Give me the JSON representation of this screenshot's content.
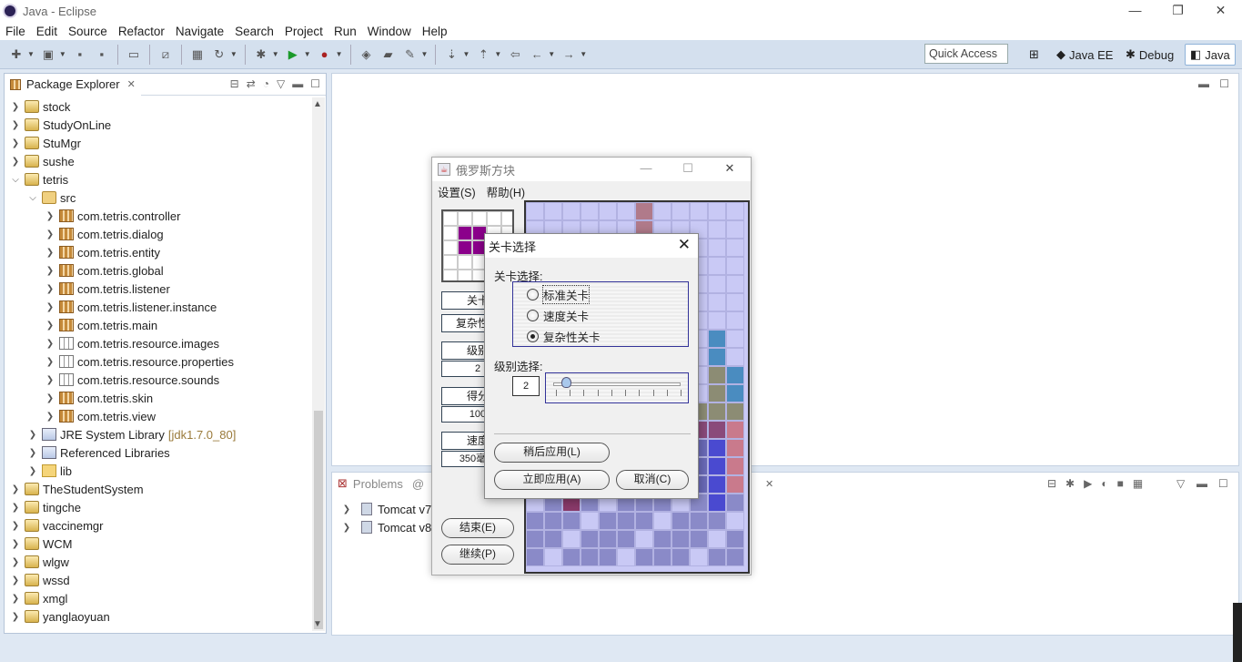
{
  "window": {
    "title": "Java - Eclipse",
    "minimize": "—",
    "restore": "❐",
    "close": "✕"
  },
  "menu": [
    "File",
    "Edit",
    "Source",
    "Refactor",
    "Navigate",
    "Search",
    "Project",
    "Run",
    "Window",
    "Help"
  ],
  "quick_access": "Quick Access",
  "perspectives": {
    "javaee": "Java EE",
    "debug": "Debug",
    "java": "Java"
  },
  "explorer": {
    "tab": "Package Explorer",
    "rows": [
      {
        "label": "stock",
        "deco": ""
      },
      {
        "label": "StudyOnLine",
        "deco": ""
      },
      {
        "label": "StuMgr",
        "deco": ""
      },
      {
        "label": "sushe",
        "deco": ""
      },
      {
        "label": "tetris",
        "deco": ""
      },
      {
        "label": "src",
        "deco": ""
      },
      {
        "label": "com.tetris.controller",
        "deco": ""
      },
      {
        "label": "com.tetris.dialog",
        "deco": ""
      },
      {
        "label": "com.tetris.entity",
        "deco": ""
      },
      {
        "label": "com.tetris.global",
        "deco": ""
      },
      {
        "label": "com.tetris.listener",
        "deco": ""
      },
      {
        "label": "com.tetris.listener.instance",
        "deco": ""
      },
      {
        "label": "com.tetris.main",
        "deco": ""
      },
      {
        "label": "com.tetris.resource.images",
        "deco": ""
      },
      {
        "label": "com.tetris.resource.properties",
        "deco": ""
      },
      {
        "label": "com.tetris.resource.sounds",
        "deco": ""
      },
      {
        "label": "com.tetris.skin",
        "deco": ""
      },
      {
        "label": "com.tetris.view",
        "deco": ""
      },
      {
        "label": "JRE System Library",
        "deco": "[jdk1.7.0_80]"
      },
      {
        "label": "Referenced Libraries",
        "deco": ""
      },
      {
        "label": "lib",
        "deco": ""
      },
      {
        "label": "TheStudentSystem",
        "deco": ""
      },
      {
        "label": "tingche",
        "deco": ""
      },
      {
        "label": "vaccinemgr",
        "deco": ""
      },
      {
        "label": "WCM",
        "deco": ""
      },
      {
        "label": "wlgw",
        "deco": ""
      },
      {
        "label": "wssd",
        "deco": ""
      },
      {
        "label": "xmgl",
        "deco": ""
      },
      {
        "label": "yanglaoyuan",
        "deco": ""
      }
    ]
  },
  "bottom": {
    "problems_tab": "Problems",
    "servers_tab_suffix": "rs",
    "servers": [
      "Tomcat v7.0",
      "Tomcat v8.0"
    ]
  },
  "tetris": {
    "title": "俄罗斯方块",
    "menu": [
      "设置(S)",
      "帮助(H)"
    ],
    "side": {
      "level_type": "关卡",
      "complex": "复杂性关",
      "level_label": "级别",
      "level_value": "2",
      "score_label": "得分",
      "score_value": "100",
      "speed_label": "速度",
      "speed_value": "350毫秒"
    },
    "end_button": "结束(E)",
    "continue_button": "继续(P)"
  },
  "dialog": {
    "title": "关卡选择",
    "group1_label": "关卡选择:",
    "options": [
      {
        "label": "标准关卡",
        "selected": false
      },
      {
        "label": "速度关卡",
        "selected": false
      },
      {
        "label": "复杂性关卡",
        "selected": true
      }
    ],
    "group2_label": "级别选择:",
    "level_value": "2",
    "slider_fraction": 0.1,
    "later_button": "稍后应用(L)",
    "apply_button": "立即应用(A)",
    "cancel_button": "取消(C)"
  }
}
